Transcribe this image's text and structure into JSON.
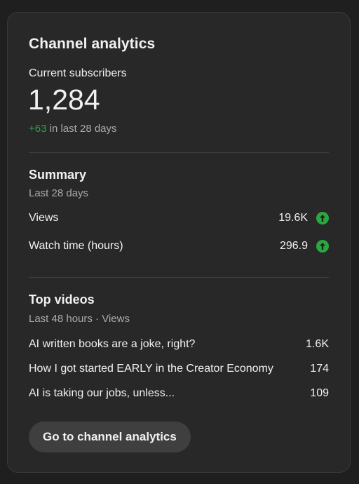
{
  "card": {
    "title": "Channel analytics",
    "subscribers_label": "Current subscribers",
    "subscribers_value": "1,284",
    "subscribers_delta": "+63",
    "subscribers_delta_suffix": "in last 28 days"
  },
  "summary": {
    "title": "Summary",
    "period": "Last 28 days",
    "metrics": [
      {
        "label": "Views",
        "value": "19.6K",
        "trend_icon": "arrow-up-circle-icon",
        "trend_color": "#2ba640"
      },
      {
        "label": "Watch time (hours)",
        "value": "296.9",
        "trend_icon": "arrow-up-circle-icon",
        "trend_color": "#2ba640"
      }
    ]
  },
  "top_videos": {
    "title": "Top videos",
    "period": "Last 48 hours · Views",
    "items": [
      {
        "title": "AI written books are a joke, right?",
        "views": "1.6K"
      },
      {
        "title": "How I got started EARLY in the Creator Economy",
        "views": "174"
      },
      {
        "title": "AI is taking our jobs, unless...",
        "views": "109"
      }
    ]
  },
  "actions": {
    "go_to_analytics_label": "Go to channel analytics"
  }
}
